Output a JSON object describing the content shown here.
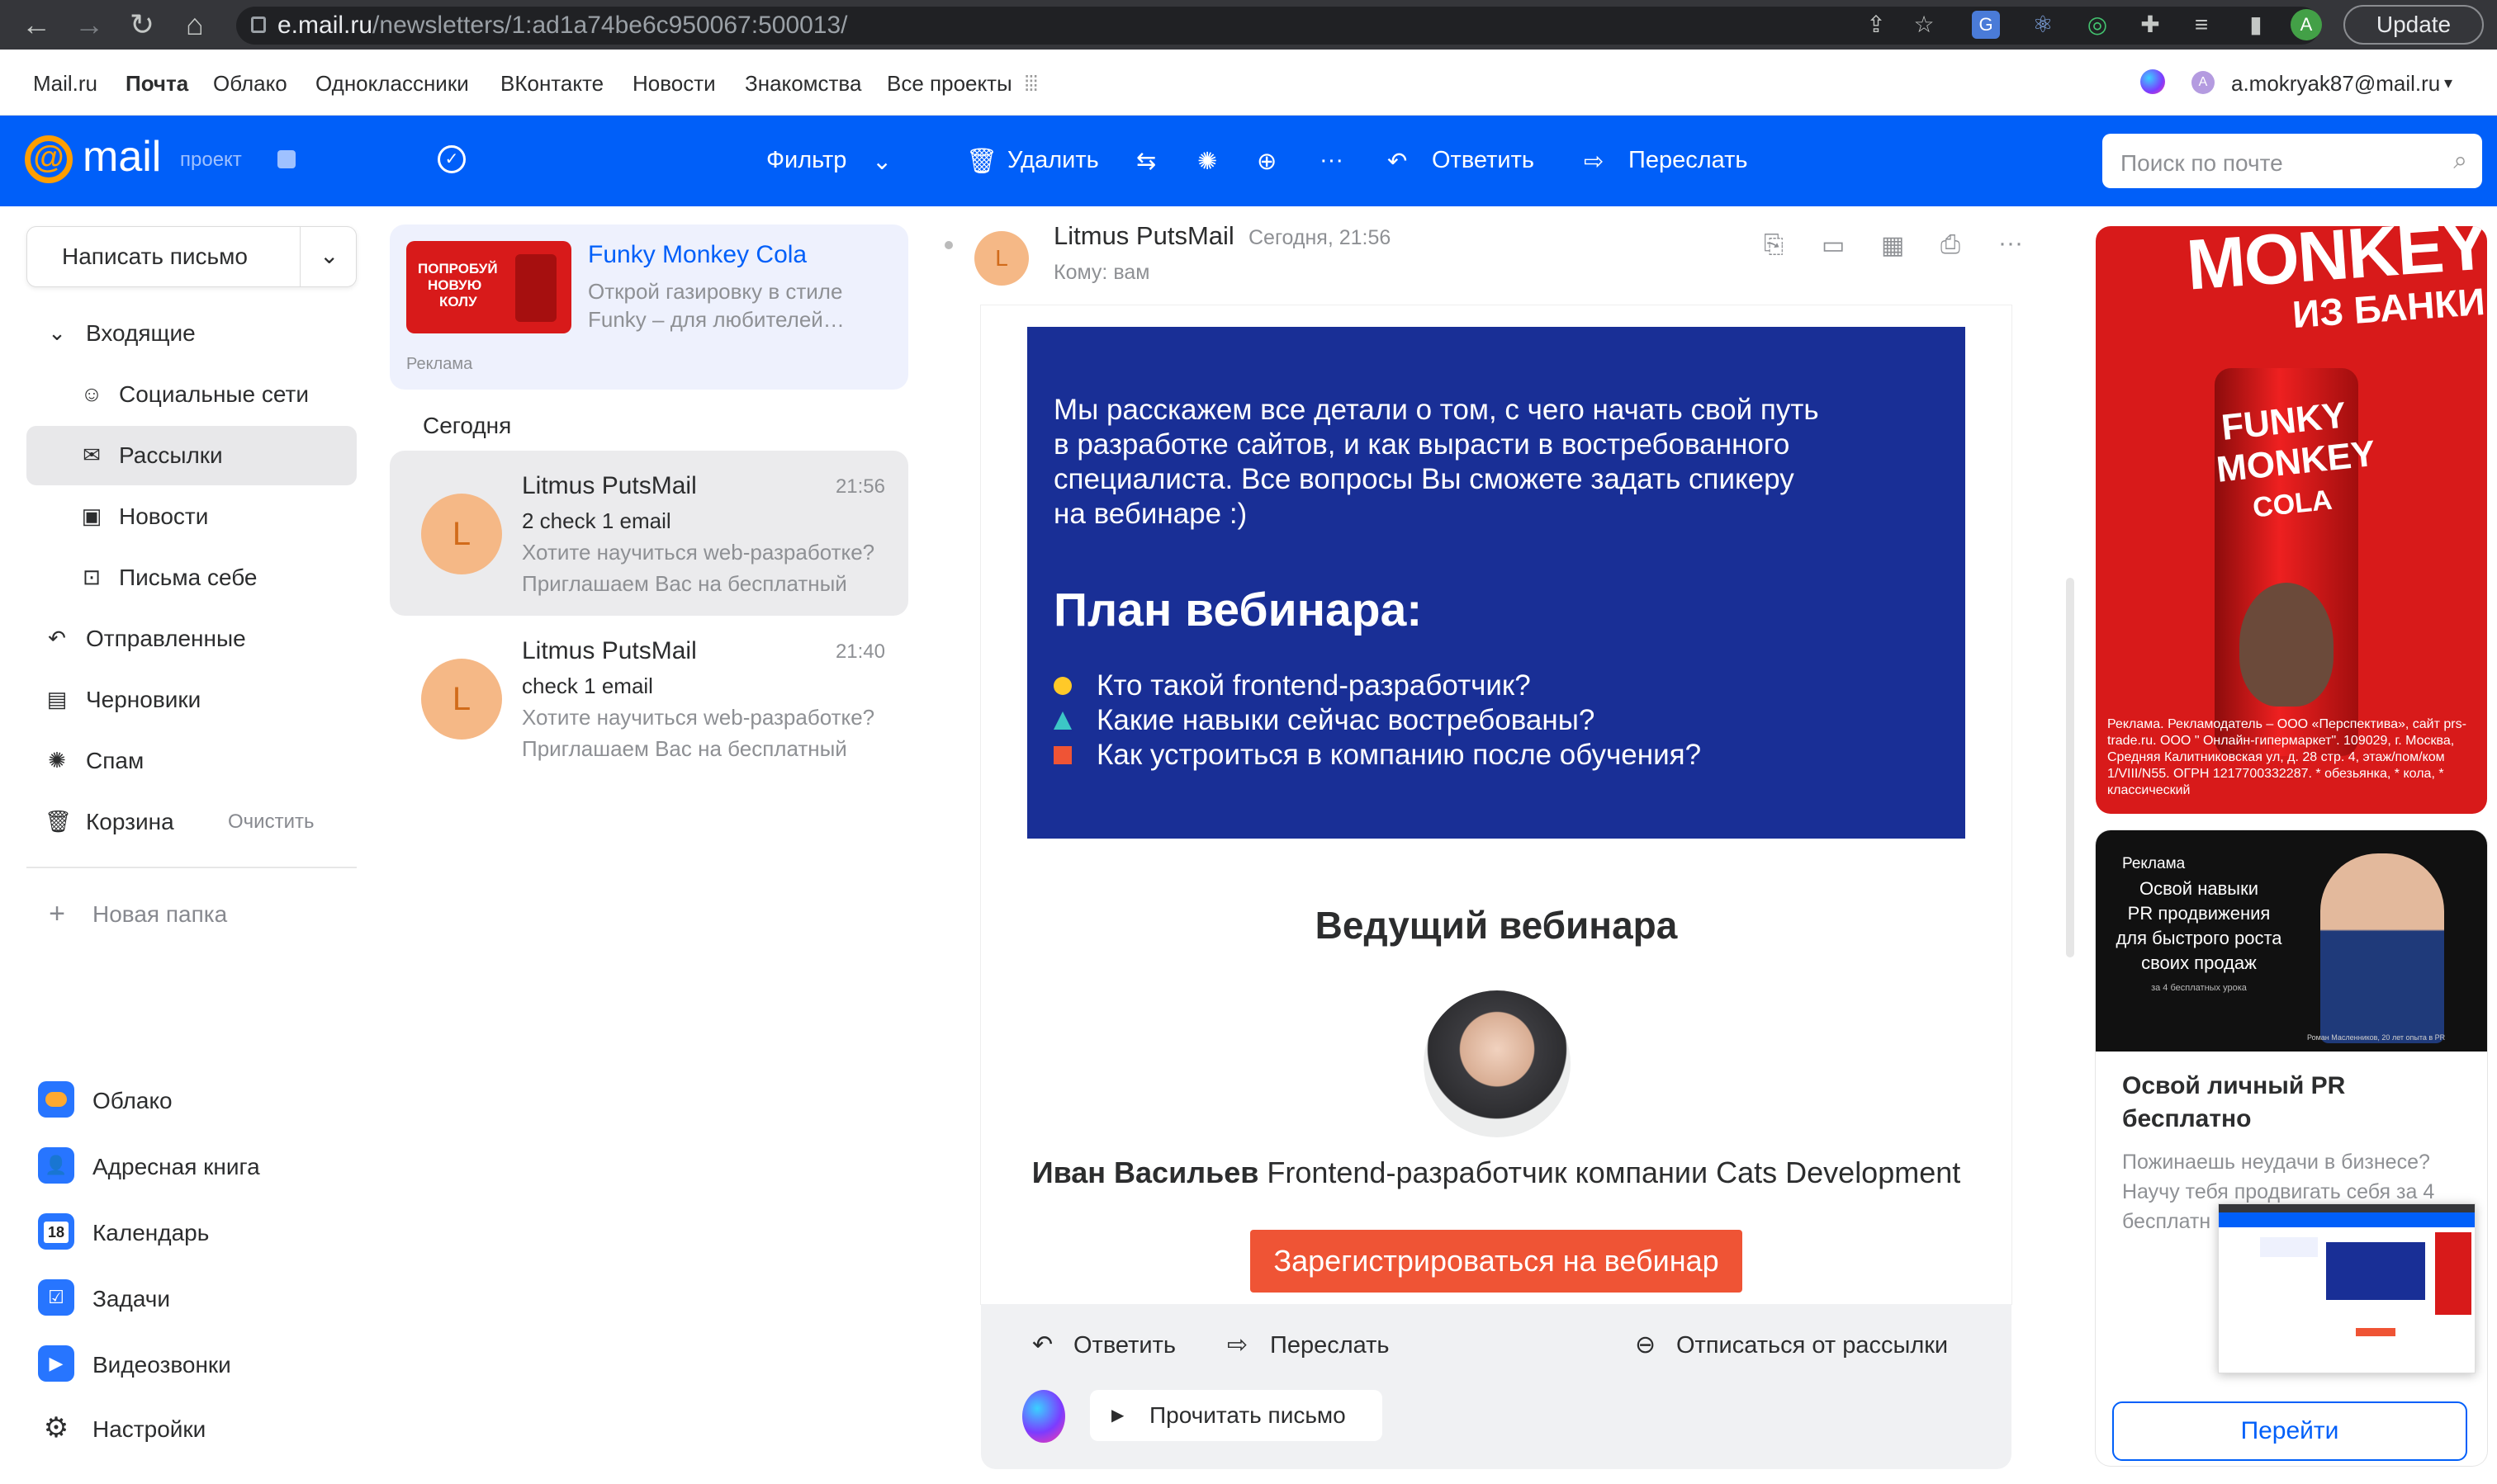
{
  "browser": {
    "url_host": "e.mail.ru",
    "url_path": "/newsletters/1:ad1a74be6c950067:500013/",
    "update_label": "Update",
    "profile_initial": "A"
  },
  "portal": {
    "links": [
      "Mail.ru",
      "Почта",
      "Облако",
      "Одноклассники",
      "ВКонтакте",
      "Новости",
      "Знакомства",
      "Все проекты"
    ],
    "account": "a.mokryak87@mail.ru",
    "account_initial": "A"
  },
  "header": {
    "logo_text": "mail",
    "logo_sub": "проект",
    "filter": "Фильтр",
    "delete": "Удалить",
    "reply": "Ответить",
    "forward": "Переслать",
    "search_placeholder": "Поиск по почте"
  },
  "sidebar": {
    "compose": "Написать письмо",
    "inbox": "Входящие",
    "social": "Социальные сети",
    "newsletters": "Рассылки",
    "news": "Новости",
    "self": "Письма себе",
    "sent": "Отправленные",
    "drafts": "Черновики",
    "spam": "Спам",
    "trash": "Корзина",
    "trash_clear": "Очистить",
    "new_folder": "Новая папка",
    "apps": [
      "Облако",
      "Адресная книга",
      "Календарь",
      "Задачи",
      "Видеозвонки",
      "Настройки"
    ],
    "calendar_day": "18"
  },
  "list": {
    "ad": {
      "title": "Funky Monkey Cola",
      "text1": "Открой газировку в стиле",
      "text2": "Funky – для любителей…",
      "label": "Реклама",
      "image_text1": "ПОПРОБУЙ",
      "image_text2": "НОВУЮ",
      "image_text3": "КОЛУ"
    },
    "section": "Сегодня",
    "messages": [
      {
        "avatar": "L",
        "from": "Litmus PutsMail",
        "time": "21:56",
        "subject": "2 check 1 email",
        "preview1": "Хотите научиться web-разработке?",
        "preview2": "Приглашаем Вас на бесплатный"
      },
      {
        "avatar": "L",
        "from": "Litmus PutsMail",
        "time": "21:40",
        "subject": "check 1 email",
        "preview1": "Хотите научиться web-разработке?",
        "preview2": "Приглашаем Вас на бесплатный"
      }
    ]
  },
  "reader": {
    "avatar": "L",
    "from": "Litmus PutsMail",
    "date": "Сегодня, 21:56",
    "to": "Кому: вам",
    "intro_lines": [
      "Мы расскажем все детали о том, с чего начать свой путь",
      "в разработке сайтов, и как вырасти в востребованного",
      "специалиста. Все вопросы Вы сможете задать спикеру",
      "на вебинаре :)"
    ],
    "plan_title": "План вебинара:",
    "plan_items": [
      "Кто такой frontend-разработчик?",
      "Какие навыки сейчас востребованы?",
      "Как устроиться в компанию после обучения?"
    ],
    "host_title": "Ведущий вебинара",
    "host_name": "Иван Васильев",
    "host_role": " Frontend-разработчик компании Cats Development",
    "register": "Зарегистрироваться на вебинар",
    "bottom_reply": "Ответить",
    "bottom_forward": "Переслать",
    "unsubscribe": "Отписаться от рассылки",
    "read_aloud": "Прочитать письмо"
  },
  "ads": {
    "ad1_title1": "MONKEY",
    "ad1_title2": "ИЗ БАНКИ",
    "ad1_can1": "FUNKY",
    "ad1_can2": "MONKEY",
    "ad1_can3": "COLA",
    "ad1_legal": "Реклама. Рекламодатель – ООО «Перспектива», сайт prs-trade.ru. ООО \" Онлайн-гипермаркет\". 109029, г. Москва, Средняя Калитниковская ул, д. 28 стр. 4, этаж/пом/ком 1/VIII/N55. ОГРН 1217700332287. * обезьянка, * кола, * классический",
    "ad2_label": "Реклама",
    "ad2_banner": [
      "Освой навыки",
      "PR продвижения",
      "для быстрого роста",
      "своих продаж"
    ],
    "ad2_banner_small": "за 4 бесплатных урока",
    "ad2_caption": "Роман Масленников, 20 лет опыта в PR",
    "ad2_title1": "Освой личный PR",
    "ad2_title2": "бесплатно",
    "ad2_text1": "Пожинаешь неудачи в бизнесе?",
    "ad2_text2": "Научу тебя продвигать себя за 4",
    "ad2_text3": "бесплатн",
    "ad2_button": "Перейти"
  },
  "colors": {
    "brand": "#005ff9",
    "letter_blue": "#192f96",
    "register": "#ef5435",
    "ad_red": "#d81a1a"
  }
}
